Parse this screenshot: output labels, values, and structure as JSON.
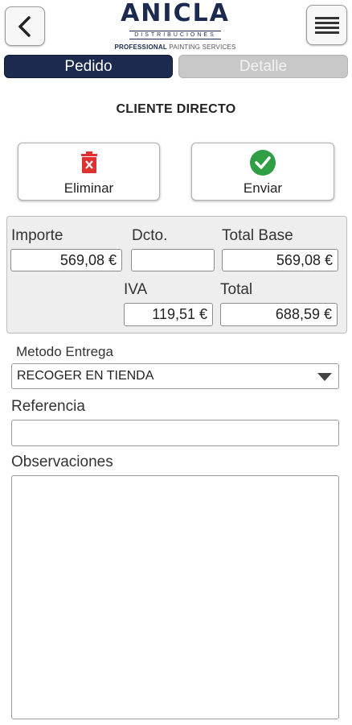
{
  "header": {
    "back_icon": "chevron-left-icon",
    "menu_icon": "hamburger-menu-icon",
    "logo": {
      "name": "ANICLA",
      "subtitle": "DISTRIBUCIONES",
      "tagline_bold": "PROFESSIONAL",
      "tagline_light": "PAINTING SERVICES"
    }
  },
  "tabs": [
    {
      "label": "Pedido",
      "active": true
    },
    {
      "label": "Detalle",
      "active": false
    }
  ],
  "client_title": "CLIENTE DIRECTO",
  "actions": {
    "delete": {
      "label": "Eliminar",
      "icon": "trash-icon",
      "color": "#e03131"
    },
    "send": {
      "label": "Enviar",
      "icon": "check-circle-icon",
      "color": "#2f9e44"
    }
  },
  "totals": {
    "importe_label": "Importe",
    "importe_value": "569,08 €",
    "dcto_label": "Dcto.",
    "dcto_value": "",
    "total_base_label": "Total Base",
    "total_base_value": "569,08 €",
    "iva_label": "IVA",
    "iva_value": "119,51 €",
    "total_label": "Total",
    "total_value": "688,59 €"
  },
  "form": {
    "metodo_label": "Metodo Entrega",
    "metodo_value": "RECOGER EN TIENDA",
    "referencia_label": "Referencia",
    "referencia_value": "",
    "observaciones_label": "Observaciones",
    "observaciones_value": ""
  },
  "colors": {
    "brand": "#1b2a4e",
    "tab_inactive": "#c8c8c8"
  }
}
